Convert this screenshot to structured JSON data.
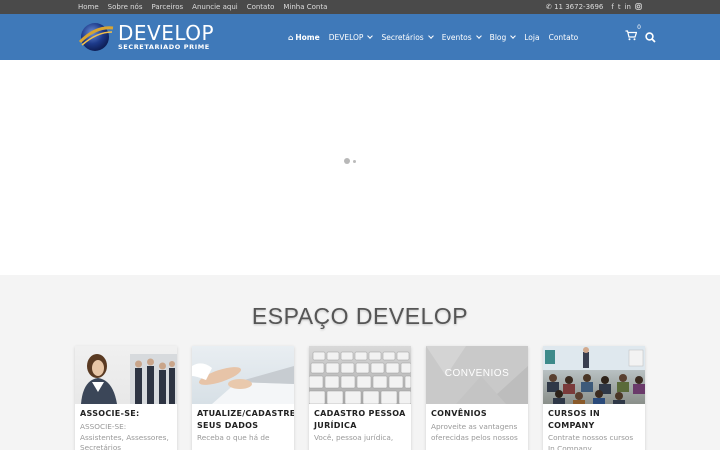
{
  "topbar": {
    "links": [
      "Home",
      "Sobre nós",
      "Parceiros",
      "Anuncie aqui",
      "Contato",
      "Minha Conta"
    ],
    "phone": "11 3672-3696",
    "social_icons": [
      "facebook-icon",
      "twitter-icon",
      "linkedin-icon",
      "instagram-icon"
    ]
  },
  "header": {
    "logo_title": "DEVELOP",
    "logo_subtitle": "SECRETARIADO PRIME",
    "nav": [
      {
        "label": "Home",
        "active": true,
        "dropdown": false
      },
      {
        "label": "DEVELOP",
        "dropdown": true
      },
      {
        "label": "Secretários",
        "dropdown": true
      },
      {
        "label": "Eventos",
        "dropdown": true
      },
      {
        "label": "Blog",
        "dropdown": true
      },
      {
        "label": "Loja",
        "dropdown": false
      },
      {
        "label": "Contato",
        "dropdown": false
      }
    ],
    "cart_count": "0"
  },
  "section": {
    "title": "ESPAÇO DEVELOP",
    "cards": [
      {
        "title": "ASSOCIE-SE:",
        "desc": "ASSOCIE-SE: Assistentes, Assessores, Secretários"
      },
      {
        "title": "ATUALIZE/CADASTRE SEUS DADOS",
        "desc": "Receba o que há de"
      },
      {
        "title": "CADASTRO PESSOA JURÍDICA",
        "desc": "Você, pessoa jurídica,"
      },
      {
        "title": "CONVÊNIOS",
        "desc": "Aproveite as vantagens oferecidas pelos nossos",
        "image_text": "CONVENIOS"
      },
      {
        "title": "CURSOS IN COMPANY",
        "desc": "Contrate nossos cursos In Company"
      }
    ]
  },
  "colors": {
    "topbar": "#4a4a4a",
    "header": "#3f79b9",
    "section_bg": "#f4f4f4"
  }
}
